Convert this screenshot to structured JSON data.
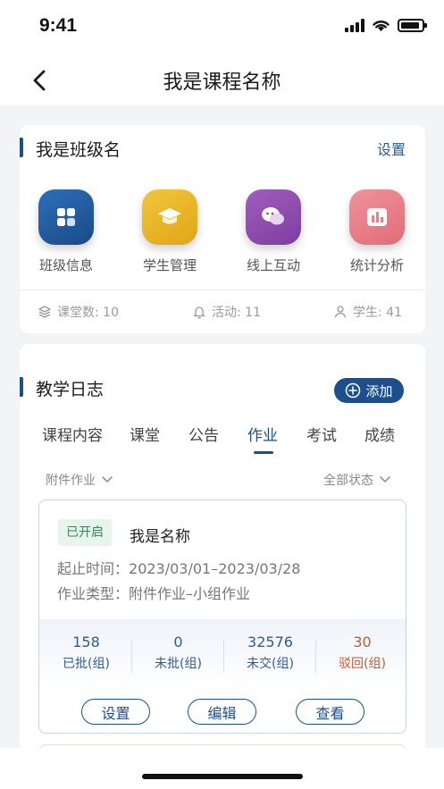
{
  "status_bar": {
    "time": "9:41"
  },
  "nav": {
    "title": "我是课程名称"
  },
  "class_card": {
    "name": "我是班级名",
    "settings": "设置",
    "features": [
      {
        "label": "班级信息",
        "icon": "grid-icon",
        "color": "#1f5aa0"
      },
      {
        "label": "学生管理",
        "icon": "graduation-cap-icon",
        "color": "#eab62a"
      },
      {
        "label": "线上互动",
        "icon": "chat-icon",
        "color": "#8e4bae"
      },
      {
        "label": "统计分析",
        "icon": "bar-chart-icon",
        "color": "#e7808a"
      }
    ],
    "stats": {
      "classes": "课堂数: 10",
      "activities": "活动: 11",
      "students": "学生: 41"
    }
  },
  "log_card": {
    "title": "教学日志",
    "add_label": "添加",
    "tabs": [
      "课程内容",
      "课堂",
      "公告",
      "作业",
      "考试",
      "成绩"
    ],
    "active_tab": "作业",
    "filter_type": "附件作业",
    "filter_status": "全部状态",
    "homework": {
      "status": "已开启",
      "name": "我是名称",
      "period_label": "起止时间：",
      "period_value": "2023/03/01–2023/03/28",
      "type_label": "作业类型：",
      "type_value": "附件作业–小组作业",
      "stats": [
        {
          "num": "158",
          "label": "已批(组)"
        },
        {
          "num": "0",
          "label": "未批(组)"
        },
        {
          "num": "32576",
          "label": "未交(组)"
        },
        {
          "num": "30",
          "label": "驳回(组)"
        }
      ],
      "buttons": [
        "设置",
        "编辑",
        "查看"
      ]
    }
  },
  "colors": {
    "primary": "#1c4f8c",
    "success": "#2f8a55",
    "warning": "#c35b2d"
  }
}
